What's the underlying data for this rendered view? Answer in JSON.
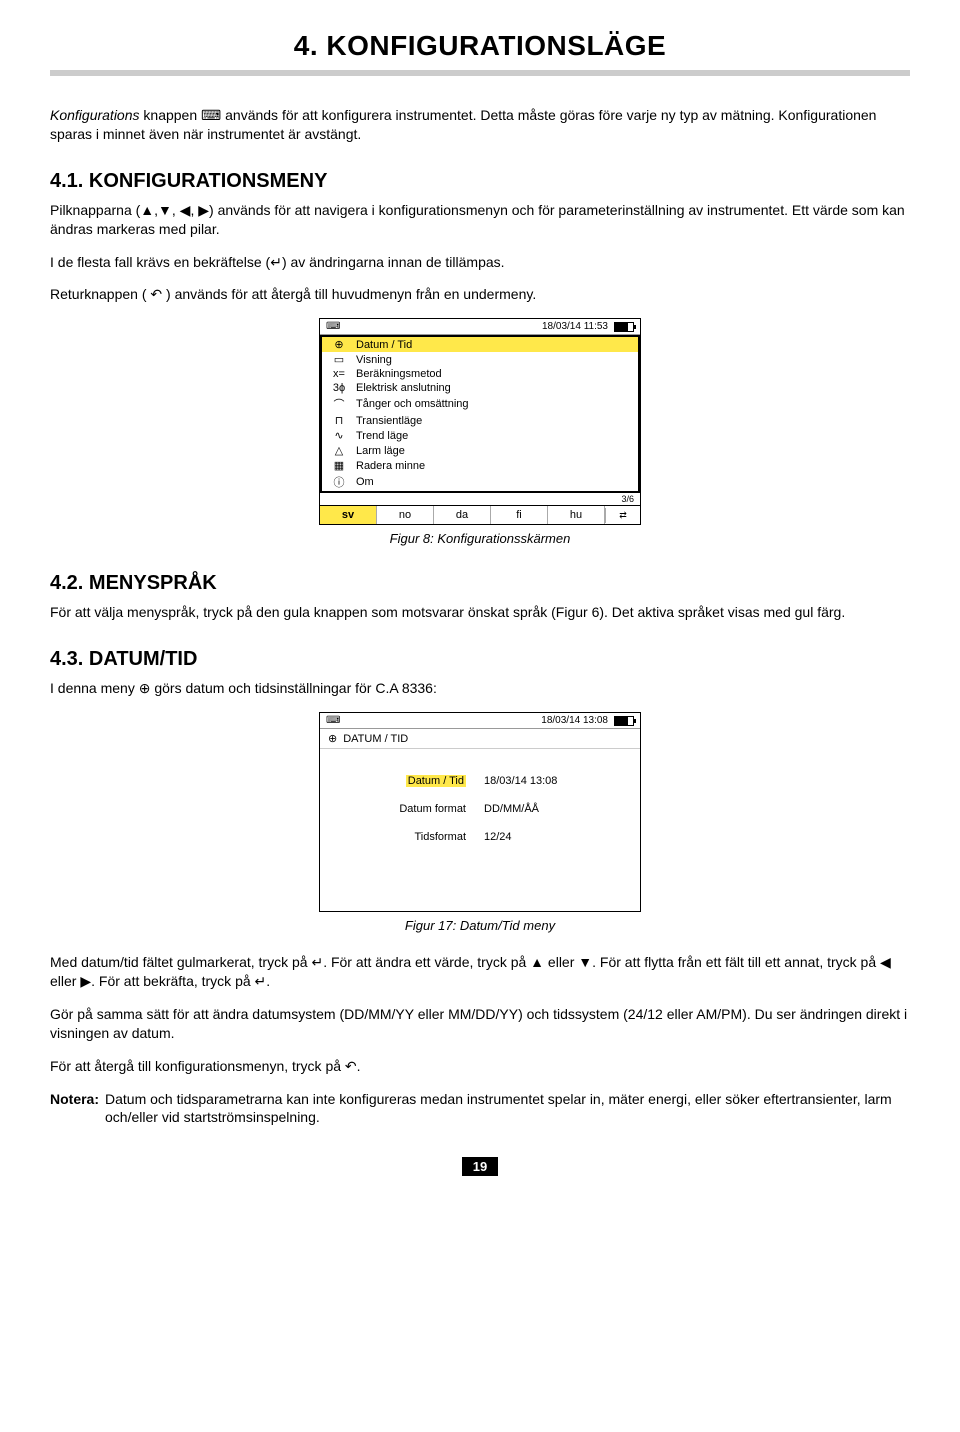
{
  "title": "4. KONFIGURATIONSLÄGE",
  "intro": {
    "p1a": "Konfigurations",
    "p1b": " knappen ",
    "p1c": " används för att konfigurera instrumentet. Detta måste göras före varje ny typ av mätning. Konfigurationen sparas i minnet även när instrumentet är avstängt."
  },
  "s41": {
    "heading": "4.1. KONFIGURATIONSMENY",
    "p1a": "Pilknapparna (",
    "p1b": ") används för att navigera i konfigurationsmenyn och för parameterinställning av instrumentet. Ett värde som kan ändras markeras med pilar.",
    "p2a": "I de flesta fall krävs en bekräftelse (",
    "p2b": ") av ändringarna innan de tillämpas.",
    "p3a": "Returknappen ( ",
    "p3b": " ) används för att återgå till huvudmenyn från en undermeny."
  },
  "figure8": {
    "datetime": "18/03/14  11:53",
    "items": [
      {
        "icon": "⊕",
        "label": "Datum / Tid"
      },
      {
        "icon": "▭",
        "label": "Visning"
      },
      {
        "icon": "x=",
        "label": "Beräkningsmetod"
      },
      {
        "icon": "3ϕ",
        "label": "Elektrisk anslutning"
      },
      {
        "icon": "⌒",
        "label": "Tånger och omsättning"
      },
      {
        "icon": "⊓",
        "label": "Transientläge"
      },
      {
        "icon": "∿",
        "label": "Trend läge"
      },
      {
        "icon": "△",
        "label": "Larm läge"
      },
      {
        "icon": "▦",
        "label": "Radera minne"
      },
      {
        "icon": "ⓘ",
        "label": "Om"
      }
    ],
    "langs": [
      "sv",
      "no",
      "da",
      "fi",
      "hu"
    ],
    "page_indicator": "3/6",
    "caption": "Figur 8: Konfigurationsskärmen"
  },
  "s42": {
    "heading": "4.2. MENYSPRÅK",
    "p1": "För att välja menyspråk, tryck på den gula knappen som motsvarar önskat språk (Figur 6). Det aktiva språket visas med gul färg."
  },
  "s43": {
    "heading": "4.3. DATUM/TID",
    "p1a": "I denna meny ",
    "p1b": " görs datum och tidsinställningar för C.A 8336:"
  },
  "figure17": {
    "datetime": "18/03/14  13:08",
    "title": "DATUM / TID",
    "rows": [
      {
        "label": "Datum / Tid",
        "value": "18/03/14  13:08",
        "hl": true
      },
      {
        "label": "Datum format",
        "value": "DD/MM/ÅÅ",
        "hl": false
      },
      {
        "label": "Tidsformat",
        "value": "12/24",
        "hl": false
      }
    ],
    "caption": "Figur 17: Datum/Tid meny"
  },
  "tail": {
    "p1a": "Med datum/tid fältet gulmarkerat, tryck på ",
    "p1b": ". För att ändra ett värde, tryck på ",
    "p1c": " eller ",
    "p1d": ". För att flytta från ett fält till ett annat, tryck på ",
    "p1e": " eller ",
    "p1f": ". För att bekräfta, tryck på ",
    "p1g": ".",
    "p2": "Gör på samma sätt för att ändra datumsystem (DD/MM/YY eller MM/DD/YY) och tidssystem (24/12 eller AM/PM). Du ser ändringen direkt i visningen av datum.",
    "p3a": "För att återgå till konfigurationsmenyn, tryck på ",
    "p3b": ".",
    "note_label": "Notera:",
    "note_text": "Datum och tidsparametrarna kan inte konfigureras medan instrumentet spelar in, mäter energi, eller söker eftertransienter, larm och/eller vid startströmsinspelning."
  },
  "page_number": "19"
}
